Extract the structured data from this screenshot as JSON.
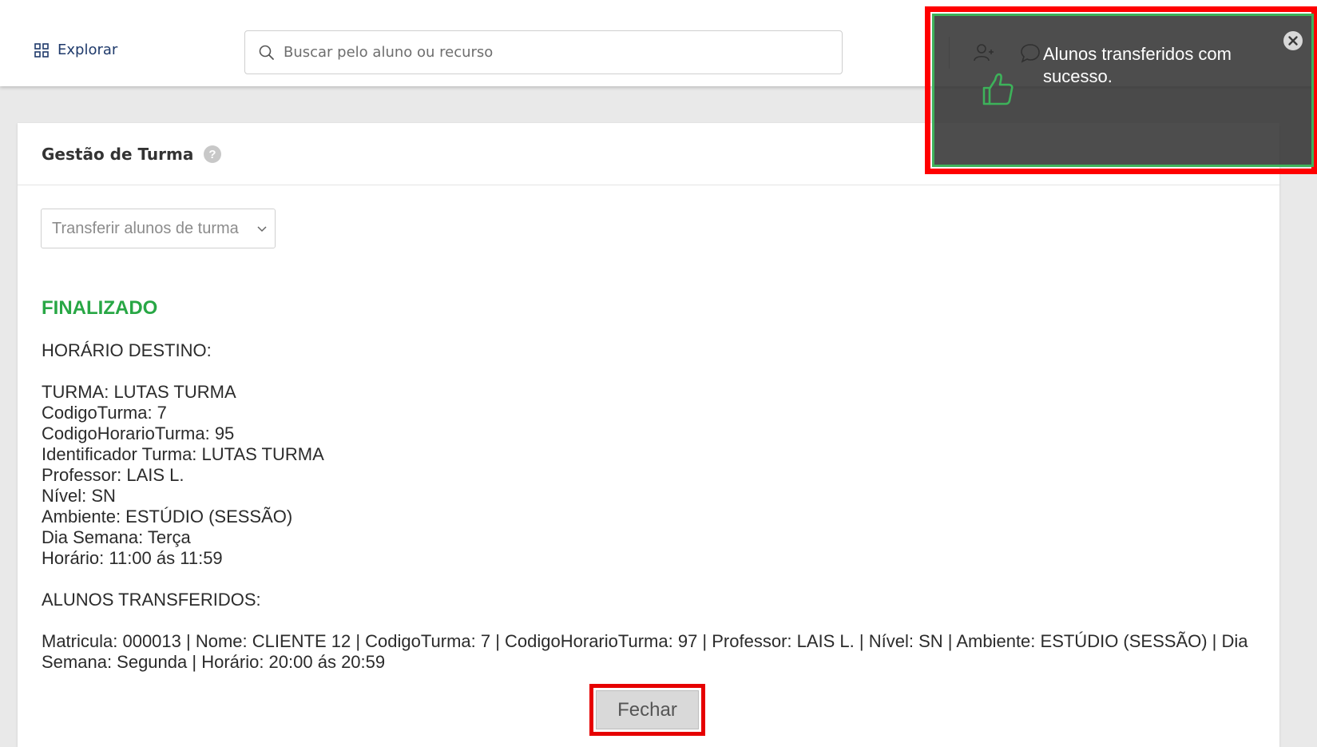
{
  "nav": {
    "explore_label": "Explorar"
  },
  "search": {
    "placeholder": "Buscar pelo aluno ou recurso"
  },
  "card": {
    "title": "Gestão de Turma",
    "select_value": "Transferir alunos de turma"
  },
  "result": {
    "status": "FINALIZADO",
    "destination_heading": "HORÁRIO DESTINO:",
    "lines": [
      "TURMA: LUTAS TURMA",
      "CodigoTurma: 7",
      "CodigoHorarioTurma: 95",
      "Identificador Turma: LUTAS TURMA",
      "Professor: LAIS L.",
      "Nível: SN",
      "Ambiente: ESTÚDIO (SESSÃO)",
      "Dia Semana: Terça",
      "Horário: 11:00 ás 11:59"
    ],
    "transferred_heading": "ALUNOS TRANSFERIDOS:",
    "transferred_line": "Matricula: 000013 | Nome: CLIENTE 12 | CodigoTurma: 7 | CodigoHorarioTurma: 97 | Professor: LAIS L. | Nível: SN | Ambiente: ESTÚDIO (SESSÃO) | Dia Semana: Segunda | Horário: 20:00 ás 20:59",
    "close_label": "Fechar"
  },
  "toast": {
    "message": "Alunos transferidos com sucesso.",
    "icon": "thumbs-up-icon"
  },
  "colors": {
    "success": "#28a745",
    "highlight": "#ff0000",
    "nav_text": "#1f3a6b"
  }
}
